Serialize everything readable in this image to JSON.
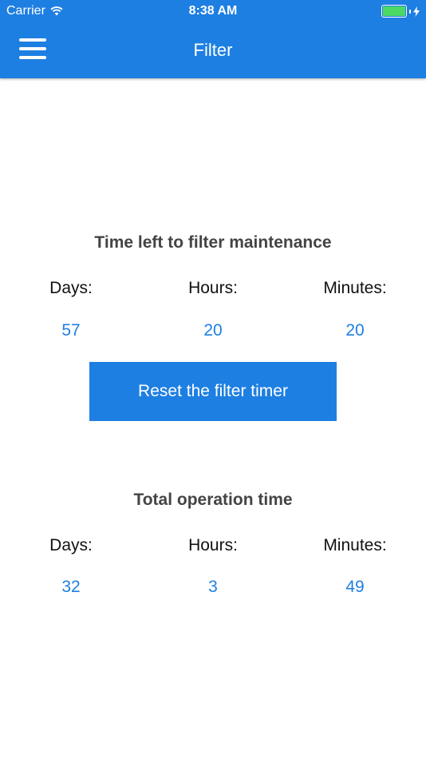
{
  "status_bar": {
    "carrier": "Carrier",
    "time": "8:38 AM"
  },
  "header": {
    "title": "Filter"
  },
  "filter_maintenance": {
    "title": "Time left to filter maintenance",
    "labels": [
      "Days:",
      "Hours:",
      "Minutes:"
    ],
    "values": [
      "57",
      "20",
      "20"
    ],
    "reset_label": "Reset the filter timer"
  },
  "operation_time": {
    "title": "Total operation time",
    "labels": [
      "Days:",
      "Hours:",
      "Minutes:"
    ],
    "values": [
      "32",
      "3",
      "49"
    ]
  },
  "colors": {
    "accent": "#1E7FE2",
    "battery": "#4CD964"
  }
}
